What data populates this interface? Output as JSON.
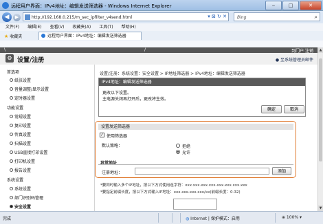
{
  "window": {
    "title": "远程用户界面：IPv4地址：编辑发送筛选器 - Windows Internet Explorer",
    "min": "‒",
    "max": "□",
    "close": "✕"
  },
  "address_bar": {
    "back": "◀",
    "forward": "▶",
    "url": "http://192.168.0.215/m_sec_ipfilter_v4send.html",
    "tools": "▾ ⊠ ↻ ✕",
    "search_placeholder": "Bing",
    "search_icon": "⌕"
  },
  "menu": [
    "文件(F)",
    "编辑(E)",
    "查看(V)",
    "收藏夹(A)",
    "工具(T)",
    "帮助(H)"
  ],
  "favorites": {
    "label": "收藏夹",
    "star": "★",
    "tab": "远程用户界面：IPv4地址：编辑发送筛选器"
  },
  "top_strip": {
    "left": "\\",
    "slash": "/",
    "right": "到门户  注销"
  },
  "header": {
    "icon": "⚙",
    "title": "设置/注册",
    "link": "● 至系统管理员邮件"
  },
  "sidebar": {
    "sec_prefs": "首选项",
    "item_paper": "纸张设置",
    "item_volume": "音量调整/显示设置",
    "item_timer": "定时器设置",
    "sec_func": "功能设置",
    "item_common": "常规设置",
    "item_copy": "复印设置",
    "item_fax": "传真设置",
    "item_scan": "扫描设置",
    "item_usb": "USB直接打印设置",
    "item_printer": "打印机设置",
    "item_report": "报告设置",
    "sec_sys": "系统设置",
    "item_sysset": "系统设置",
    "item_dept": "部门识别码管理",
    "item_security": "安全设置"
  },
  "breadcrumb": "设置/注册：系统设置：安全设置 > IP地址筛选器 > IPv4地址：编辑发送筛选器",
  "panel": {
    "title": "IPv4地址：编辑发送筛选器",
    "msg1": "更改以下设置。",
    "msg2": "主电源关闭再打开后，更改将生效。",
    "ok": "确定",
    "cancel": "取消"
  },
  "settings": {
    "title": "设置发送筛选器",
    "use_filter": "使用筛选器",
    "use_filter_checked": true,
    "check_mark": "✓",
    "default_policy_label": "默认策略：",
    "option_reject": "拒绝",
    "option_allow": "允许",
    "selected": "允许"
  },
  "exception": {
    "title": "异常地址",
    "register_label": "注册地址：",
    "register_value": "",
    "add": "添加"
  },
  "notes": {
    "n1": "*要同时输入多个IP地址，按以下方式使用连字符：xxx.xxx.xxx.xxx-xxx.xxx.xxx.xxx",
    "n2": "*要指定前缀长度，按以下方式输入IP地址：xxx.xxx.xxx.xxx/xx(前缀长度：0-32)"
  },
  "scrollbar": {
    "up": "▲",
    "down": "▼"
  },
  "status": {
    "done": "完成",
    "globe": "◍",
    "zone": "Internet | 保护模式：启用",
    "zoom": "⊕ 100%  ▾"
  }
}
